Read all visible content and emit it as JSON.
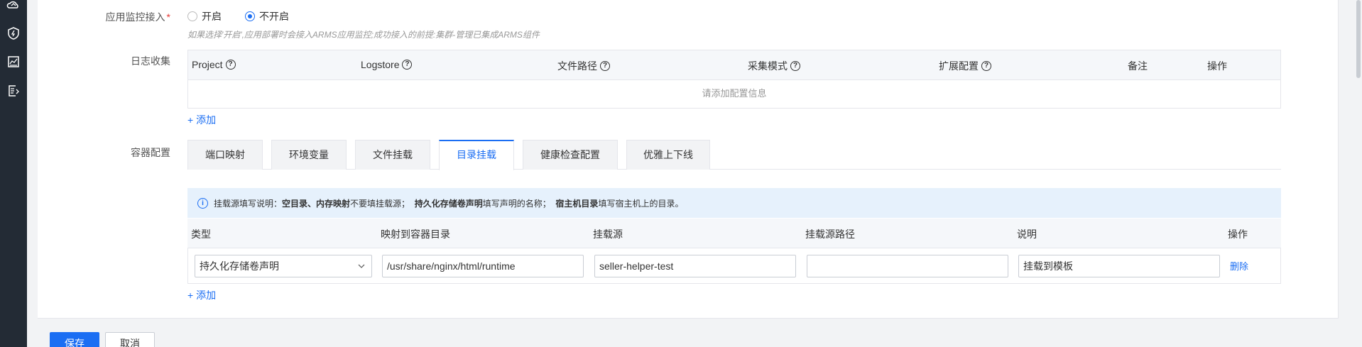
{
  "sidebar": {
    "icons": [
      "cloud-icon",
      "shield-icon",
      "chart-icon",
      "export-icon"
    ]
  },
  "monitor": {
    "label": "应用监控接入",
    "required_mark": "*",
    "option_on": "开启",
    "option_off": "不开启",
    "selected": "不开启",
    "hint": "如果选择'开启',应用部署时会接入ARMS应用监控;成功接入的前提:集群-管理已集成ARMS组件"
  },
  "log": {
    "label": "日志收集",
    "columns": [
      "Project",
      "Logstore",
      "文件路径",
      "采集模式",
      "扩展配置",
      "备注",
      "操作"
    ],
    "empty_text": "请添加配置信息",
    "add_label": "+ 添加"
  },
  "container": {
    "label": "容器配置",
    "tabs": [
      "端口映射",
      "环境变量",
      "文件挂载",
      "目录挂载",
      "健康检查配置",
      "优雅上下线"
    ],
    "active_tab": "目录挂载",
    "info": {
      "prefix": "挂载源填写说明：",
      "bold1": "空目录、内存映射",
      "text1": "不要填挂载源；",
      "bold2": "持久化存储卷声明",
      "text2": "填写声明的名称；",
      "bold3": "宿主机目录",
      "text3": "填写宿主机上的目录。"
    },
    "mount_columns": [
      "类型",
      "映射到容器目录",
      "挂载源",
      "挂载源路径",
      "说明",
      "操作"
    ],
    "rows": [
      {
        "type": "持久化存储卷声明",
        "container_path": "/usr/share/nginx/html/runtime",
        "source": "seller-helper-test",
        "source_path": "",
        "description": "挂载到模板",
        "action": "删除"
      }
    ],
    "add_label": "+ 添加"
  },
  "footer": {
    "save_label": "保存",
    "cancel_label": "取消"
  },
  "colors": {
    "primary": "#1b6ef3",
    "sidebar_bg": "#232b35",
    "info_bg": "#e6f1fc"
  }
}
